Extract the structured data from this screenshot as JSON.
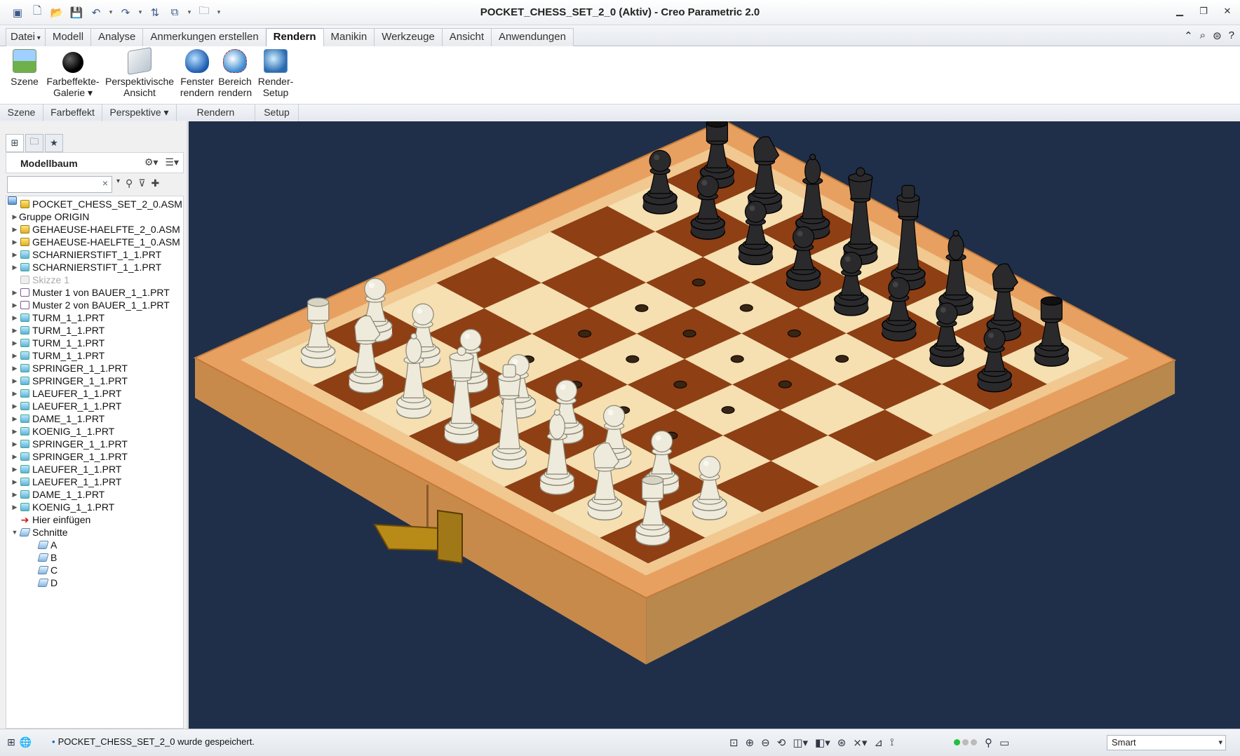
{
  "window": {
    "title": "POCKET_CHESS_SET_2_0 (Aktiv) - Creo Parametric 2.0",
    "controls": [
      "minimize-icon",
      "restore-icon",
      "close-icon"
    ]
  },
  "quick_access": [
    "new-icon",
    "open-icon",
    "save-icon",
    "undo-icon",
    "redo-icon",
    "regenerate-icon",
    "windows-icon",
    "folder-icon",
    "customize-icon"
  ],
  "tabs": [
    {
      "label": "Datei",
      "active": false
    },
    {
      "label": "Modell",
      "active": false
    },
    {
      "label": "Analyse",
      "active": false
    },
    {
      "label": "Anmerkungen erstellen",
      "active": false
    },
    {
      "label": "Rendern",
      "active": true
    },
    {
      "label": "Manikin",
      "active": false
    },
    {
      "label": "Werkzeuge",
      "active": false
    },
    {
      "label": "Ansicht",
      "active": false
    },
    {
      "label": "Anwendungen",
      "active": false
    }
  ],
  "ribbon": {
    "buttons": [
      {
        "line1": "Szene",
        "line2": "",
        "icon": "scene-icon"
      },
      {
        "line1": "Farbeffekte-",
        "line2": "Galerie ▾",
        "icon": "color-effects-icon"
      },
      {
        "line1": "Perspektivische",
        "line2": "Ansicht",
        "icon": "perspective-icon"
      },
      {
        "line1": "Fenster",
        "line2": "rendern",
        "icon": "render-window-icon"
      },
      {
        "line1": "Bereich",
        "line2": "rendern",
        "icon": "render-region-icon"
      },
      {
        "line1": "Render-",
        "line2": "Setup",
        "icon": "render-setup-icon"
      }
    ],
    "groups": [
      "Szene",
      "Farbeffekt",
      "Perspektive ▾",
      "Rendern",
      "Setup"
    ]
  },
  "model_tree": {
    "title": "Modellbaum",
    "search_value": "",
    "items": [
      {
        "label": "POCKET_CHESS_SET_2_0.ASM",
        "type": "asm",
        "level": 0,
        "expander": ""
      },
      {
        "label": "Gruppe ORIGIN",
        "type": "grp",
        "level": 1,
        "expander": "▶"
      },
      {
        "label": "GEHAEUSE-HAELFTE_2_0.ASM",
        "type": "asm",
        "level": 1,
        "expander": "▶"
      },
      {
        "label": "GEHAEUSE-HAELFTE_1_0.ASM",
        "type": "asm",
        "level": 1,
        "expander": "▶"
      },
      {
        "label": "SCHARNIERSTIFT_1_1.PRT",
        "type": "prt",
        "level": 1,
        "expander": "▶"
      },
      {
        "label": "SCHARNIERSTIFT_1_1.PRT",
        "type": "prt",
        "level": 1,
        "expander": "▶"
      },
      {
        "label": "Skizze 1",
        "type": "sk",
        "level": 1,
        "expander": "",
        "dim": true
      },
      {
        "label": "Muster 1 von BAUER_1_1.PRT",
        "type": "pat",
        "level": 1,
        "expander": "▶"
      },
      {
        "label": "Muster 2 von BAUER_1_1.PRT",
        "type": "pat",
        "level": 1,
        "expander": "▶"
      },
      {
        "label": "TURM_1_1.PRT",
        "type": "prt",
        "level": 1,
        "expander": "▶"
      },
      {
        "label": "TURM_1_1.PRT",
        "type": "prt",
        "level": 1,
        "expander": "▶"
      },
      {
        "label": "TURM_1_1.PRT",
        "type": "prt",
        "level": 1,
        "expander": "▶"
      },
      {
        "label": "TURM_1_1.PRT",
        "type": "prt",
        "level": 1,
        "expander": "▶"
      },
      {
        "label": "SPRINGER_1_1.PRT",
        "type": "prt",
        "level": 1,
        "expander": "▶"
      },
      {
        "label": "SPRINGER_1_1.PRT",
        "type": "prt",
        "level": 1,
        "expander": "▶"
      },
      {
        "label": "LAEUFER_1_1.PRT",
        "type": "prt",
        "level": 1,
        "expander": "▶"
      },
      {
        "label": "LAEUFER_1_1.PRT",
        "type": "prt",
        "level": 1,
        "expander": "▶"
      },
      {
        "label": "DAME_1_1.PRT",
        "type": "prt",
        "level": 1,
        "expander": "▶"
      },
      {
        "label": "KOENIG_1_1.PRT",
        "type": "prt",
        "level": 1,
        "expander": "▶"
      },
      {
        "label": "SPRINGER_1_1.PRT",
        "type": "prt",
        "level": 1,
        "expander": "▶"
      },
      {
        "label": "SPRINGER_1_1.PRT",
        "type": "prt",
        "level": 1,
        "expander": "▶"
      },
      {
        "label": "LAEUFER_1_1.PRT",
        "type": "prt",
        "level": 1,
        "expander": "▶"
      },
      {
        "label": "LAEUFER_1_1.PRT",
        "type": "prt",
        "level": 1,
        "expander": "▶"
      },
      {
        "label": "DAME_1_1.PRT",
        "type": "prt",
        "level": 1,
        "expander": "▶"
      },
      {
        "label": "KOENIG_1_1.PRT",
        "type": "prt",
        "level": 1,
        "expander": "▶"
      },
      {
        "label": "Hier einfügen",
        "type": "insert",
        "level": 1,
        "expander": ""
      },
      {
        "label": "Schnitte",
        "type": "cut",
        "level": 1,
        "expander": "▼"
      },
      {
        "label": "A",
        "type": "cut",
        "level": 2,
        "expander": ""
      },
      {
        "label": "B",
        "type": "cut",
        "level": 2,
        "expander": ""
      },
      {
        "label": "C",
        "type": "cut",
        "level": 2,
        "expander": ""
      },
      {
        "label": "D",
        "type": "cut",
        "level": 2,
        "expander": ""
      }
    ]
  },
  "viewport": {
    "background": "#1f2f4a",
    "board_dark": "#8e3f14",
    "board_light": "#f6dfb0",
    "frame_top": "#e8a060",
    "frame_side": "#c88a4a",
    "white_piece": "#efebdc",
    "black_piece": "#2a2a2c",
    "latch": "#b88a18"
  },
  "statusbar": {
    "message": "POCKET_CHESS_SET_2_0 wurde gespeichert.",
    "filter_value": "Smart"
  }
}
